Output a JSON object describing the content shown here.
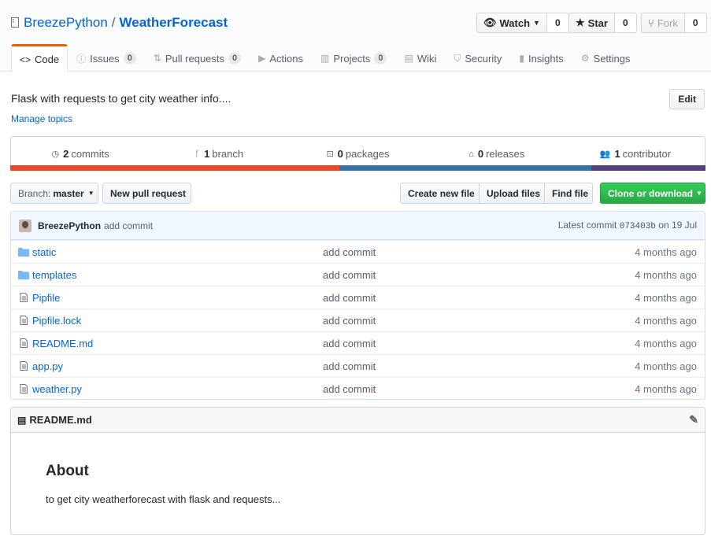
{
  "repo": {
    "owner": "BreezePython",
    "separator": "/",
    "name": "WeatherForecast"
  },
  "actions": {
    "watch_label": "Watch",
    "watch_count": "0",
    "star_label": "Star",
    "star_count": "0",
    "fork_label": "Fork",
    "fork_count": "0"
  },
  "tabs": [
    {
      "label": "Code",
      "icon": "code-icon"
    },
    {
      "label": "Issues",
      "badge": "0",
      "icon": "issue-icon"
    },
    {
      "label": "Pull requests",
      "badge": "0",
      "icon": "pull-request-icon"
    },
    {
      "label": "Actions",
      "icon": "play-icon"
    },
    {
      "label": "Projects",
      "badge": "0",
      "icon": "project-icon"
    },
    {
      "label": "Wiki",
      "icon": "book-icon"
    },
    {
      "label": "Security",
      "icon": "shield-icon"
    },
    {
      "label": "Insights",
      "icon": "graph-icon"
    },
    {
      "label": "Settings",
      "icon": "gear-icon"
    }
  ],
  "description": "Flask with requests to get city weather info....",
  "manage_topics": "Manage topics",
  "edit_label": "Edit",
  "summary": {
    "commits_num": "2",
    "commits_label": "commits",
    "branch_num": "1",
    "branch_label": "branch",
    "packages_num": "0",
    "packages_label": "packages",
    "releases_num": "0",
    "releases_label": "releases",
    "contributor_num": "1",
    "contributor_label": "contributor"
  },
  "language_colors": [
    "#e34c26",
    "#3572a5",
    "#563d7c"
  ],
  "file_nav": {
    "branch_prefix": "Branch:",
    "branch_name": "master",
    "new_pr": "New pull request",
    "create_file": "Create new file",
    "upload_files": "Upload files",
    "find_file": "Find file",
    "clone": "Clone or download"
  },
  "latest_commit": {
    "author": "BreezePython",
    "message": "add commit",
    "prefix": "Latest commit",
    "sha": "073403b",
    "date": "on 19 Jul"
  },
  "files": [
    {
      "name": "static",
      "type": "dir",
      "message": "add commit",
      "age": "4 months ago"
    },
    {
      "name": "templates",
      "type": "dir",
      "message": "add commit",
      "age": "4 months ago"
    },
    {
      "name": "Pipfile",
      "type": "file",
      "message": "add commit",
      "age": "4 months ago"
    },
    {
      "name": "Pipfile.lock",
      "type": "file",
      "message": "add commit",
      "age": "4 months ago"
    },
    {
      "name": "README.md",
      "type": "file",
      "message": "add commit",
      "age": "4 months ago"
    },
    {
      "name": "app.py",
      "type": "file",
      "message": "add commit",
      "age": "4 months ago"
    },
    {
      "name": "weather.py",
      "type": "file",
      "message": "add commit",
      "age": "4 months ago"
    }
  ],
  "readme": {
    "filename": "README.md",
    "heading": "About",
    "body": "to get city weatherforecast with flask and requests..."
  }
}
